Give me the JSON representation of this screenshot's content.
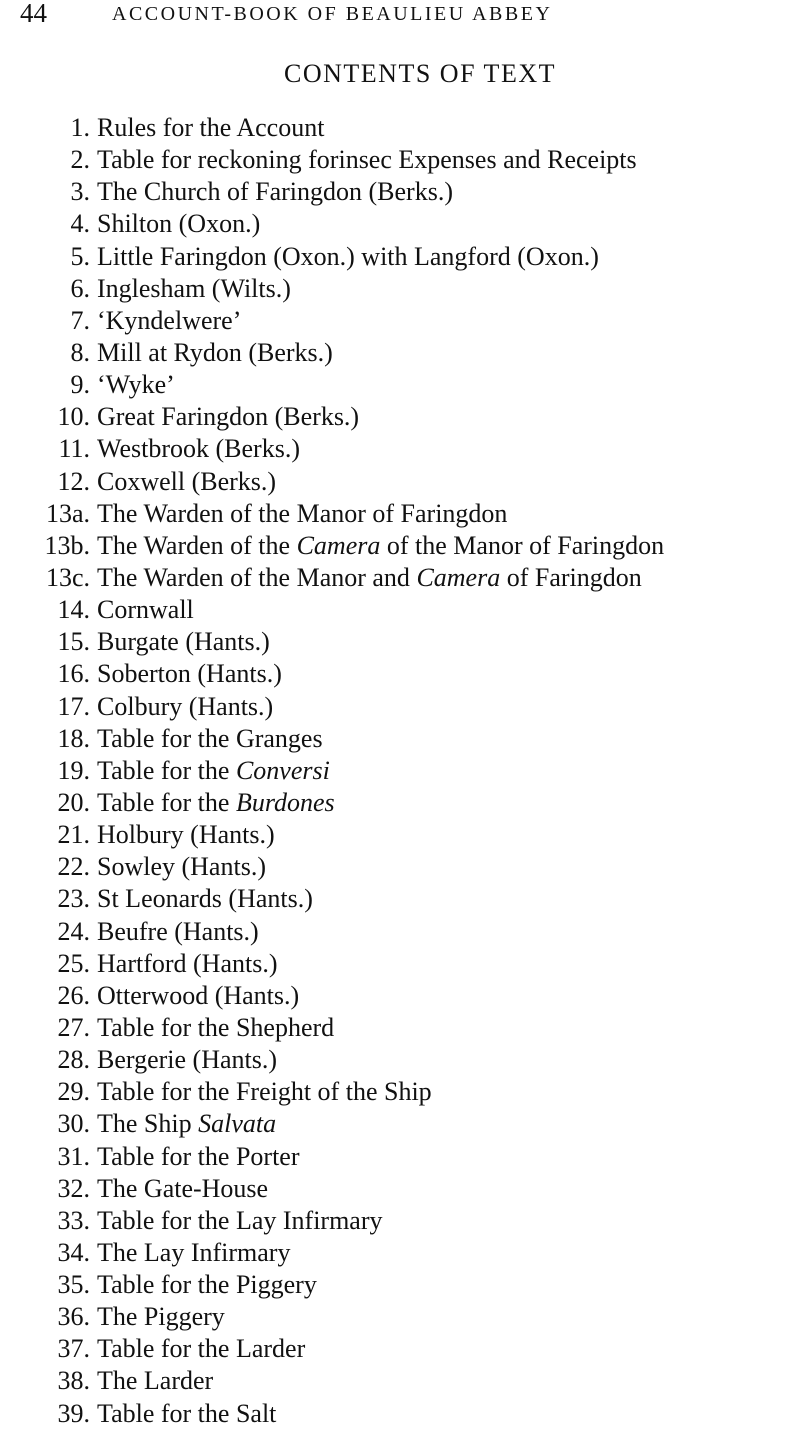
{
  "header": {
    "page_number": "44",
    "running_title": "ACCOUNT-BOOK OF BEAULIEU ABBEY"
  },
  "section_title": "CONTENTS OF TEXT",
  "entries": [
    {
      "num": "1.",
      "parts": [
        {
          "t": "Rules for the Account"
        }
      ]
    },
    {
      "num": "2.",
      "parts": [
        {
          "t": "Table for reckoning forinsec Expenses and Receipts"
        }
      ]
    },
    {
      "num": "3.",
      "parts": [
        {
          "t": "The Church of Faringdon (Berks.)"
        }
      ]
    },
    {
      "num": "4.",
      "parts": [
        {
          "t": "Shilton (Oxon.)"
        }
      ]
    },
    {
      "num": "5.",
      "parts": [
        {
          "t": "Little Faringdon (Oxon.) with Langford (Oxon.)"
        }
      ]
    },
    {
      "num": "6.",
      "parts": [
        {
          "t": "Inglesham (Wilts.)"
        }
      ]
    },
    {
      "num": "7.",
      "parts": [
        {
          "t": "‘Kyndelwere’"
        }
      ]
    },
    {
      "num": "8.",
      "parts": [
        {
          "t": "Mill at Rydon (Berks.)"
        }
      ]
    },
    {
      "num": "9.",
      "parts": [
        {
          "t": "‘Wyke’"
        }
      ]
    },
    {
      "num": "10.",
      "parts": [
        {
          "t": "Great Faringdon (Berks.)"
        }
      ]
    },
    {
      "num": "11.",
      "parts": [
        {
          "t": "Westbrook (Berks.)"
        }
      ]
    },
    {
      "num": "12.",
      "parts": [
        {
          "t": "Coxwell (Berks.)"
        }
      ]
    },
    {
      "num": "13a.",
      "parts": [
        {
          "t": "The Warden of the Manor of Faringdon"
        }
      ]
    },
    {
      "num": "13b.",
      "parts": [
        {
          "t": "The Warden of the "
        },
        {
          "t": "Camera",
          "i": true
        },
        {
          "t": " of the Manor of Faringdon"
        }
      ]
    },
    {
      "num": "13c.",
      "parts": [
        {
          "t": "The Warden of the Manor and "
        },
        {
          "t": "Camera",
          "i": true
        },
        {
          "t": " of Faringdon"
        }
      ]
    },
    {
      "num": "14.",
      "parts": [
        {
          "t": "Cornwall"
        }
      ]
    },
    {
      "num": "15.",
      "parts": [
        {
          "t": "Burgate (Hants.)"
        }
      ]
    },
    {
      "num": "16.",
      "parts": [
        {
          "t": "Soberton (Hants.)"
        }
      ]
    },
    {
      "num": "17.",
      "parts": [
        {
          "t": "Colbury (Hants.)"
        }
      ]
    },
    {
      "num": "18.",
      "parts": [
        {
          "t": "Table for the Granges"
        }
      ]
    },
    {
      "num": "19.",
      "parts": [
        {
          "t": "Table for the "
        },
        {
          "t": "Conversi",
          "i": true
        }
      ]
    },
    {
      "num": "20.",
      "parts": [
        {
          "t": "Table for the "
        },
        {
          "t": "Burdones",
          "i": true
        }
      ]
    },
    {
      "num": "21.",
      "parts": [
        {
          "t": "Holbury (Hants.)"
        }
      ]
    },
    {
      "num": "22.",
      "parts": [
        {
          "t": "Sowley (Hants.)"
        }
      ]
    },
    {
      "num": "23.",
      "parts": [
        {
          "t": "St Leonards (Hants.)"
        }
      ]
    },
    {
      "num": "24.",
      "parts": [
        {
          "t": "Beufre (Hants.)"
        }
      ]
    },
    {
      "num": "25.",
      "parts": [
        {
          "t": "Hartford (Hants.)"
        }
      ]
    },
    {
      "num": "26.",
      "parts": [
        {
          "t": "Otterwood (Hants.)"
        }
      ]
    },
    {
      "num": "27.",
      "parts": [
        {
          "t": "Table for the Shepherd"
        }
      ]
    },
    {
      "num": "28.",
      "parts": [
        {
          "t": "Bergerie (Hants.)"
        }
      ]
    },
    {
      "num": "29.",
      "parts": [
        {
          "t": "Table for the Freight of the Ship"
        }
      ]
    },
    {
      "num": "30.",
      "parts": [
        {
          "t": "The Ship "
        },
        {
          "t": "Salvata",
          "i": true
        }
      ]
    },
    {
      "num": "31.",
      "parts": [
        {
          "t": "Table for the Porter"
        }
      ]
    },
    {
      "num": "32.",
      "parts": [
        {
          "t": "The Gate-House"
        }
      ]
    },
    {
      "num": "33.",
      "parts": [
        {
          "t": "Table for the Lay Infirmary"
        }
      ]
    },
    {
      "num": "34.",
      "parts": [
        {
          "t": "The Lay Infirmary"
        }
      ]
    },
    {
      "num": "35.",
      "parts": [
        {
          "t": "Table for the Piggery"
        }
      ]
    },
    {
      "num": "36.",
      "parts": [
        {
          "t": "The Piggery"
        }
      ]
    },
    {
      "num": "37.",
      "parts": [
        {
          "t": "Table for the Larder"
        }
      ]
    },
    {
      "num": "38.",
      "parts": [
        {
          "t": "The Larder"
        }
      ]
    },
    {
      "num": "39.",
      "parts": [
        {
          "t": "Table for the Salt"
        }
      ]
    }
  ]
}
